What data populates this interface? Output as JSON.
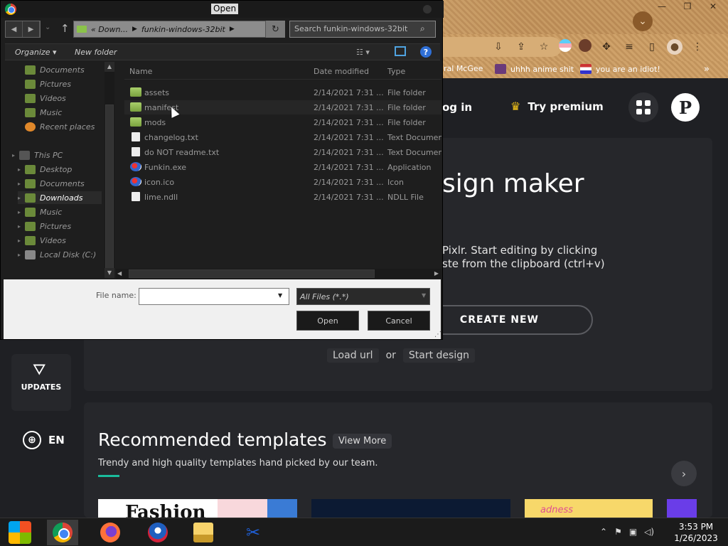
{
  "browser": {
    "bookmarks": [
      {
        "label": "ral McGee"
      },
      {
        "label": "uhhh anime shit"
      },
      {
        "label": "you are an idiot!"
      }
    ],
    "bookmarks_more": "»"
  },
  "pixlr": {
    "login": "og in",
    "premium": "Try premium",
    "hero_title": "sign maker",
    "hero_sub1": "Pixlr. Start editing by clicking",
    "hero_sub2": "ste from the clipboard (ctrl+v)",
    "create_new": "CREATE NEW",
    "load_url": "Load url",
    "or": "or",
    "start_design": "Start design",
    "updates": "UPDATES",
    "lang": "EN",
    "templates_title": "Recommended templates",
    "view_more": "View More",
    "templates_desc": "Trendy and high quality templates hand picked by our team.",
    "thumb_fashion": "Fashion",
    "thumb_sadness": "adness"
  },
  "dialog": {
    "title": "Open",
    "breadcrumb": [
      "« Down...",
      "funkin-windows-32bit"
    ],
    "search_placeholder": "Search funkin-windows-32bit",
    "organize": "Organize",
    "new_folder": "New folder",
    "nav_items": [
      {
        "label": "Documents",
        "indent": 1
      },
      {
        "label": "Pictures",
        "indent": 1
      },
      {
        "label": "Videos",
        "indent": 1
      },
      {
        "label": "Music",
        "indent": 1
      },
      {
        "label": "Recent places",
        "indent": 1
      },
      {
        "label": "This PC",
        "indent": 0
      },
      {
        "label": "Desktop",
        "indent": 1
      },
      {
        "label": "Documents",
        "indent": 1
      },
      {
        "label": "Downloads",
        "indent": 1,
        "selected": true
      },
      {
        "label": "Music",
        "indent": 1
      },
      {
        "label": "Pictures",
        "indent": 1
      },
      {
        "label": "Videos",
        "indent": 1
      },
      {
        "label": "Local Disk (C:)",
        "indent": 1
      }
    ],
    "columns": {
      "name": "Name",
      "date": "Date modified",
      "type": "Type"
    },
    "files": [
      {
        "name": "assets",
        "date": "2/14/2021 7:31 ...",
        "type": "File folder",
        "icon": "folder"
      },
      {
        "name": "manifest",
        "date": "2/14/2021 7:31 ...",
        "type": "File folder",
        "icon": "folder"
      },
      {
        "name": "mods",
        "date": "2/14/2021 7:31 ...",
        "type": "File folder",
        "icon": "folder"
      },
      {
        "name": "changelog.txt",
        "date": "2/14/2021 7:31 ...",
        "type": "Text Documen",
        "icon": "txt"
      },
      {
        "name": "do NOT readme.txt",
        "date": "2/14/2021 7:31 ...",
        "type": "Text Documen",
        "icon": "txt"
      },
      {
        "name": "Funkin.exe",
        "date": "2/14/2021 7:31 ...",
        "type": "Application",
        "icon": "exe"
      },
      {
        "name": "icon.ico",
        "date": "2/14/2021 7:31 ...",
        "type": "Icon",
        "icon": "exe"
      },
      {
        "name": "lime.ndll",
        "date": "2/14/2021 7:31 ...",
        "type": "NDLL File",
        "icon": "txt"
      }
    ],
    "file_name_label": "File name:",
    "file_name_value": "",
    "filter": "All Files (*.*)",
    "open_button": "Open",
    "cancel_button": "Cancel"
  },
  "taskbar": {
    "time": "3:53 PM",
    "date": "1/26/2023"
  }
}
